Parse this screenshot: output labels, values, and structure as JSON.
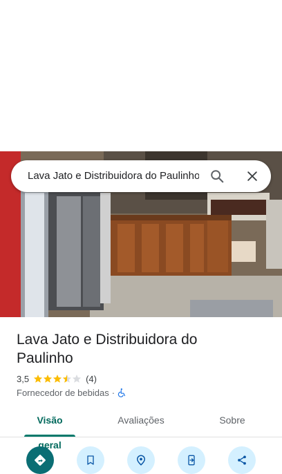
{
  "search": {
    "query": "Lava Jato e Distribuidora do Paulinho"
  },
  "place": {
    "title": "Lava Jato e Distribuidora do Paulinho",
    "rating": "3,5",
    "stars": 3.5,
    "review_count": "(4)",
    "category": "Fornecedor de bebidas",
    "separator": "·"
  },
  "tabs": [
    "Visão geral",
    "Avaliações",
    "Sobre"
  ],
  "actions": [
    "directions-icon",
    "save-icon",
    "nearby-icon",
    "send-to-phone-icon",
    "share-icon"
  ],
  "colors": {
    "accent": "#00796b",
    "star": "#fbbc04",
    "action_bg": "#d4f0ff",
    "primary_action": "#0b6e74"
  }
}
